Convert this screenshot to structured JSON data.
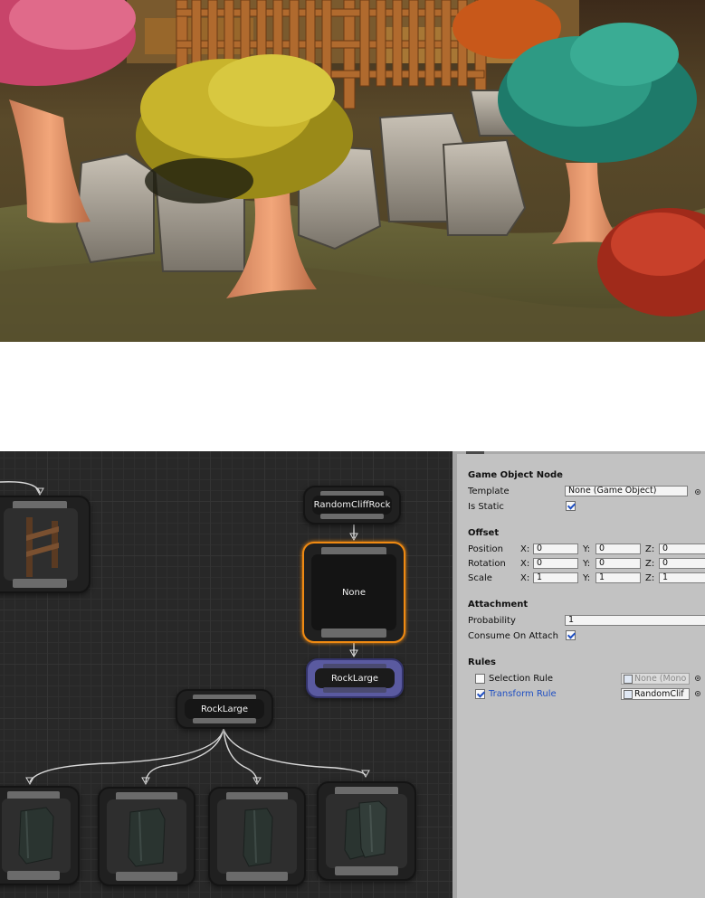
{
  "scene": {
    "description_icon": "forest-scene-image"
  },
  "graph": {
    "nodes": {
      "random_cliff_rock": "RandomCliffRock",
      "none_node": "None",
      "rock_large_selected_child": "RockLarge",
      "rock_large_parent": "RockLarge"
    }
  },
  "inspector": {
    "section_title": "Game Object Node",
    "template_label": "Template",
    "template_value": "None (Game Object)",
    "is_static_label": "Is Static",
    "is_static_checked": true,
    "offset_title": "Offset",
    "position_label": "Position",
    "rotation_label": "Rotation",
    "scale_label": "Scale",
    "axis_x": "X:",
    "axis_y": "Y:",
    "axis_z": "Z:",
    "position": {
      "x": "0",
      "y": "0",
      "z": "0"
    },
    "rotation": {
      "x": "0",
      "y": "0",
      "z": "0"
    },
    "scale": {
      "x": "1",
      "y": "1",
      "z": "1"
    },
    "attachment_title": "Attachment",
    "probability_label": "Probability",
    "probability_value": "1",
    "consume_label": "Consume On Attach",
    "consume_checked": true,
    "rules_title": "Rules",
    "selection_rule_label": "Selection Rule",
    "selection_rule_value": "None (Mono",
    "selection_rule_checked": false,
    "transform_rule_label": "Transform Rule",
    "transform_rule_value": "RandomClif",
    "transform_rule_checked": true
  }
}
